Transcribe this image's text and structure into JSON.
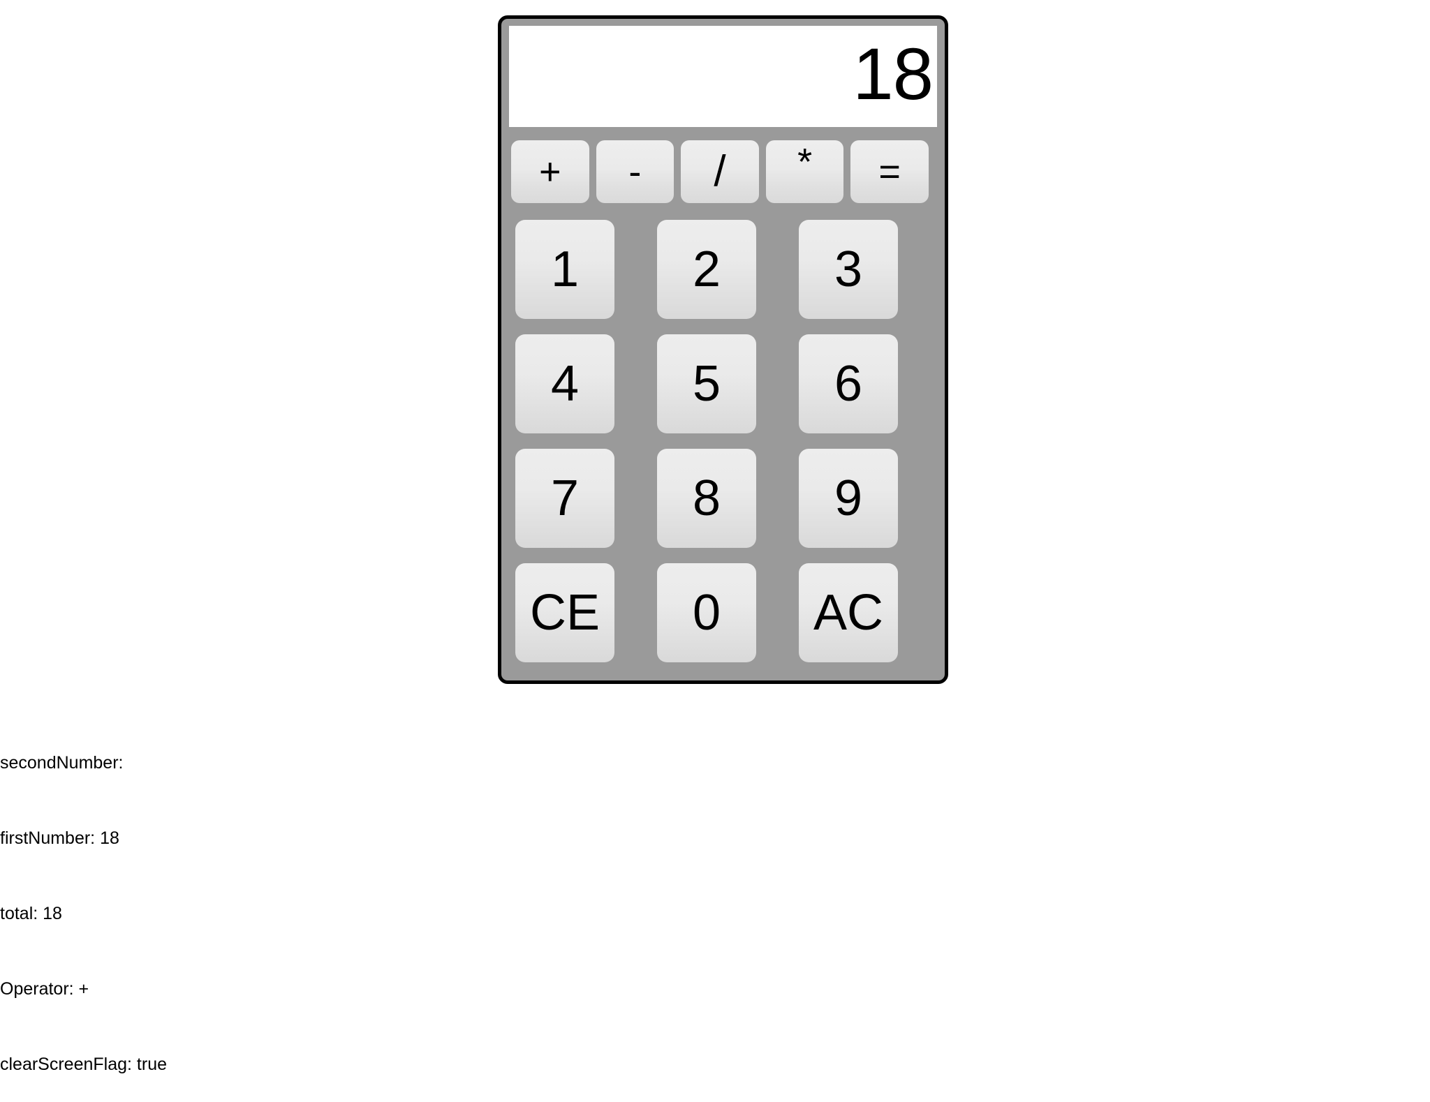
{
  "calculator": {
    "display": {
      "value": "18"
    },
    "operator_keys": [
      {
        "label": "+",
        "name": "add-button"
      },
      {
        "label": "-",
        "name": "subtract-button"
      },
      {
        "label": "/",
        "name": "divide-button"
      },
      {
        "label": "*",
        "name": "multiply-button"
      },
      {
        "label": "=",
        "name": "equals-button"
      }
    ],
    "number_keys": [
      {
        "label": "1"
      },
      {
        "label": "2"
      },
      {
        "label": "3"
      },
      {
        "label": "4"
      },
      {
        "label": "5"
      },
      {
        "label": "6"
      },
      {
        "label": "7"
      },
      {
        "label": "8"
      },
      {
        "label": "9"
      },
      {
        "label": "CE"
      },
      {
        "label": "0"
      },
      {
        "label": "AC"
      }
    ]
  },
  "state_readout": {
    "lines": [
      "secondNumber:",
      "firstNumber: 18",
      "total: 18",
      "Operator: +",
      "clearScreenFlag: true"
    ],
    "second_number": "secondNumber:",
    "first_number": "firstNumber: 18",
    "total": "total: 18",
    "operator": "Operator: +",
    "clear_screen_flag": "clearScreenFlag: true"
  },
  "colors": {
    "body_gray": "#9a9a9a",
    "frame_black": "#000000",
    "display_white": "#ffffff",
    "key_light": "#ededed",
    "key_dark": "#d9d9d9",
    "text_black": "#000000"
  }
}
